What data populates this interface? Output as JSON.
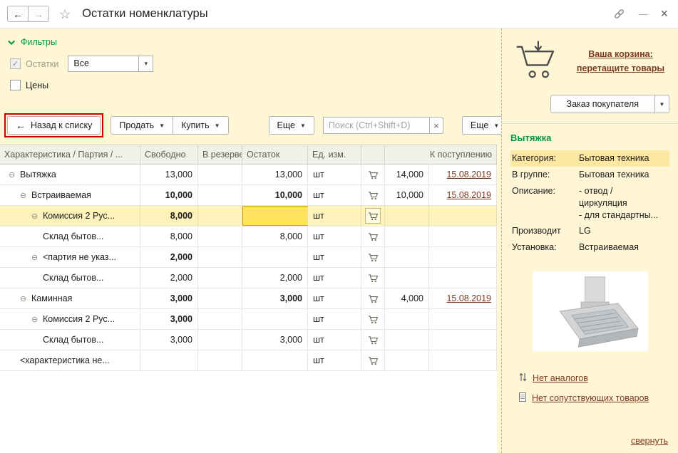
{
  "window": {
    "title": "Остатки номенклатуры"
  },
  "colors": {
    "panel_bg": "#FFF6D5",
    "accent_green": "#009846",
    "link": "#7C3B21",
    "selection_cell": "#FFE35C",
    "selection_row": "#FFF3BD",
    "annotation_red": "#C00000"
  },
  "filters": {
    "header": "Фильтры",
    "stock_label": "Остатки",
    "stock_value": "Все",
    "price_label": "Цены"
  },
  "toolbar": {
    "back_label": "Назад к списку",
    "sell_label": "Продать",
    "buy_label": "Купить",
    "more_label": "Еще",
    "search_placeholder": "Поиск (Ctrl+Shift+D)",
    "more2_label": "Еще"
  },
  "table": {
    "columns": {
      "name": "Характеристика / Партия / ...",
      "free": "Свободно",
      "reserve": "В резерве",
      "rest": "Остаток",
      "unit": "Ед. изм.",
      "incoming": "К поступлению"
    },
    "rows": [
      {
        "name": "Вытяжка",
        "free": "13,000",
        "reserve": "",
        "rest": "13,000",
        "unit": "шт",
        "in_qty": "14,000",
        "in_date": "15.08.2019"
      },
      {
        "name": "Встраиваемая",
        "free": "10,000",
        "reserve": "",
        "rest": "10,000",
        "unit": "шт",
        "in_qty": "10,000",
        "in_date": "15.08.2019"
      },
      {
        "name": "Комиссия 2 Рус...",
        "free": "8,000",
        "reserve": "",
        "rest": "",
        "unit": "шт",
        "in_qty": "",
        "in_date": ""
      },
      {
        "name": "Склад бытов...",
        "free": "8,000",
        "reserve": "",
        "rest": "8,000",
        "unit": "шт",
        "in_qty": "",
        "in_date": ""
      },
      {
        "name": "<партия не указ...",
        "free": "2,000",
        "reserve": "",
        "rest": "",
        "unit": "шт",
        "in_qty": "",
        "in_date": ""
      },
      {
        "name": "Склад бытов...",
        "free": "2,000",
        "reserve": "",
        "rest": "2,000",
        "unit": "шт",
        "in_qty": "",
        "in_date": ""
      },
      {
        "name": "Каминная",
        "free": "3,000",
        "reserve": "",
        "rest": "3,000",
        "unit": "шт",
        "in_qty": "4,000",
        "in_date": "15.08.2019"
      },
      {
        "name": "Комиссия 2 Рус...",
        "free": "3,000",
        "reserve": "",
        "rest": "",
        "unit": "шт",
        "in_qty": "",
        "in_date": ""
      },
      {
        "name": "Склад бытов...",
        "free": "3,000",
        "reserve": "",
        "rest": "3,000",
        "unit": "шт",
        "in_qty": "",
        "in_date": ""
      },
      {
        "name": "<характеристика не...",
        "free": "",
        "reserve": "",
        "rest": "",
        "unit": "шт",
        "in_qty": "",
        "in_date": ""
      }
    ]
  },
  "cart_panel": {
    "link_line1": "Ваша корзина:",
    "link_line2": "перетащите товары",
    "order_button": "Заказ покупателя"
  },
  "product": {
    "name": "Вытяжка",
    "fields": [
      {
        "label": "Категория:",
        "value": "Бытовая техника"
      },
      {
        "label": "В группе:",
        "value": "Бытовая техника"
      },
      {
        "label": "Описание:",
        "value": "- отвод /\nциркуляция\n- для стандартны..."
      },
      {
        "label": "Производит",
        "value": "LG"
      },
      {
        "label": "Установка:",
        "value": "Встраиваемая"
      }
    ],
    "analogs_link": "Нет аналогов",
    "related_link": "Нет сопутствующих товаров"
  },
  "footer": {
    "collapse_link": "свернуть"
  }
}
